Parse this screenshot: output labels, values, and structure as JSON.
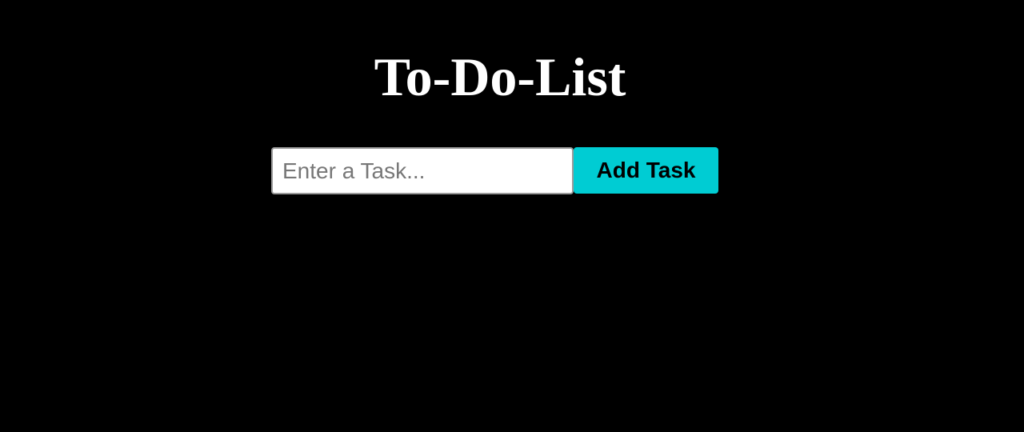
{
  "header": {
    "title": "To-Do-List"
  },
  "task_entry": {
    "input_value": "",
    "input_placeholder": "Enter a Task...",
    "add_button_label": "Add Task"
  },
  "colors": {
    "background": "#000000",
    "title_text": "#ffffff",
    "button_background": "#00ccd3",
    "button_text": "#000000"
  },
  "tasks": []
}
